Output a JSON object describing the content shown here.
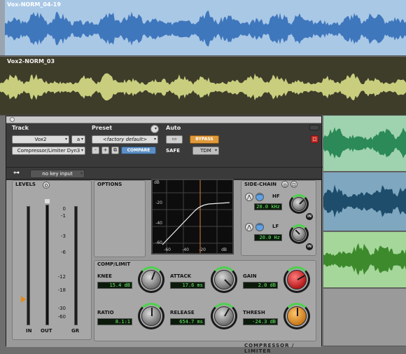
{
  "tracks": [
    {
      "name": "Vox-NORM_04-19",
      "color": "#3f77bd",
      "bg": "#a9c8e6"
    },
    {
      "name": "Vox2-NORM_03",
      "color": "#c9ce7e",
      "bg": "#3e3d2a"
    }
  ],
  "plugin": {
    "track_header": "Track",
    "preset_header": "Preset",
    "auto_header": "Auto",
    "track_name": "Vox2",
    "track_channel": "a",
    "insert_name": "Compressor/Limiter Dyn3",
    "preset_value": "<factory default>",
    "minus_label": "-",
    "plus_label": "+",
    "compare_label": "COMPARE",
    "bypass_label": "BYPASS",
    "safe_label": "SAFE",
    "format_label": "TDM",
    "key_input": "no key input",
    "levels_title": "LEVELS",
    "options_title": "OPTIONS",
    "sidechain_title": "SIDE-CHAIN",
    "complimit_title": "COMP/LIMIT",
    "meter_scale": [
      "0",
      "-1",
      "-3",
      "-6",
      "-12",
      "-18",
      "-30",
      "-60"
    ],
    "meter_labels": {
      "in": "IN",
      "out": "OUT",
      "gr": "GR"
    },
    "graph_y_ticks": [
      "-20",
      "-40",
      "-60"
    ],
    "graph_y_top": "dB",
    "graph_x_ticks": [
      "-60",
      "-40",
      "-20",
      "dB"
    ],
    "hf_label": "HF",
    "hf_value": "20.0 kHz",
    "lf_label": "LF",
    "lf_value": "20.0 Hz",
    "in_label": "IN",
    "knee_label": "KNEE",
    "knee_value": "15.4 dB",
    "attack_label": "ATTACK",
    "attack_value": "17.6 ms",
    "gain_label": "GAIN",
    "gain_value": "2.0 dB",
    "ratio_label": "RATIO",
    "ratio_value": "8.1:1",
    "release_label": "RELEASE",
    "release_value": "654.7 ms",
    "thresh_label": "THRESH",
    "thresh_value": "-24.3 dB",
    "footer_right": "COMPRESSOR / LIMITER"
  },
  "colors": {
    "accent_blue": "#5e8fc4",
    "bypass": "#e19a3a",
    "lcd": "#6ef06e",
    "gain_knob": "#b51a1a",
    "thresh_knob": "#c9791a"
  }
}
